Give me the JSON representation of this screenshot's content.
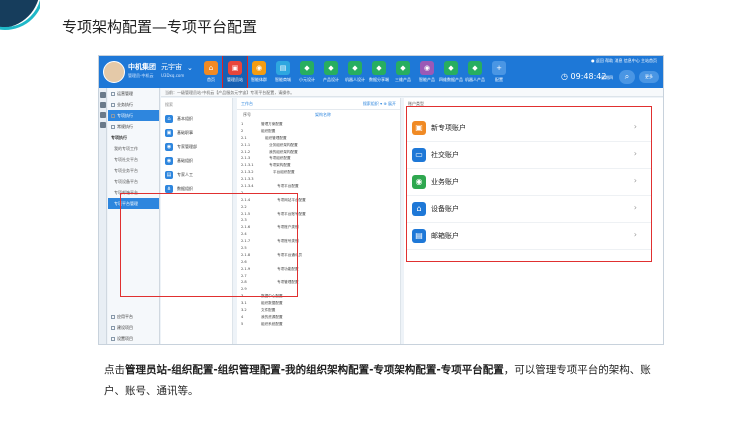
{
  "slide": {
    "title": "专项架构配置—专项平台配置",
    "caption_lead": "点击",
    "caption_path": "管理员站-组织配置-组织管理配置-我的组织架构配置-专项架构配置-专项平台配置",
    "caption_tail": "，可以管理专项平台的架构、账户、账号、通讯等。"
  },
  "app": {
    "company": "中机集团",
    "company_sub": "管理员-中机云",
    "universe": "元宇宙",
    "universe_sub": "U3Dxq.com",
    "nav": [
      {
        "label": "首页",
        "color": "#f08a24",
        "icon": "⌂"
      },
      {
        "label": "管理员站",
        "color": "#e8463c",
        "icon": "▣",
        "active": true
      },
      {
        "label": "智能体群",
        "color": "#f39c12",
        "icon": "◉"
      },
      {
        "label": "智能商城",
        "color": "#2ea7e0",
        "icon": "▤"
      },
      {
        "label": "小元设计",
        "color": "#27ae60",
        "icon": "◆"
      },
      {
        "label": "产品设计",
        "color": "#27ae60",
        "icon": "◆"
      },
      {
        "label": "机器人设计",
        "color": "#27ae60",
        "icon": "◆"
      },
      {
        "label": "数据分享端",
        "color": "#27ae60",
        "icon": "◆"
      },
      {
        "label": "三维产品",
        "color": "#27ae60",
        "icon": "◆"
      },
      {
        "label": "智能产品",
        "color": "#9b59b6",
        "icon": "◉"
      },
      {
        "label": "四维数据产品",
        "color": "#27ae60",
        "icon": "◆"
      },
      {
        "label": "机器人产品",
        "color": "#27ae60",
        "icon": "◆"
      },
      {
        "label": "配置",
        "color": "#4a96e4",
        "icon": "+"
      }
    ],
    "top_links": "● 返回   帮助   消息   信息中心   主站首页",
    "clock": "◷ 09:48:42",
    "clock_sub": "星期四",
    "search_icon": "⌕",
    "more": "更多",
    "crumb": "当前：一级管理员站·中机云【产品服务元宇宙】专项平台配置，请操作。",
    "sidebar": [
      {
        "label": "运营管理",
        "type": "item"
      },
      {
        "label": "业务执行",
        "type": "item"
      },
      {
        "label": "专项执行",
        "type": "active"
      },
      {
        "label": "常规执行",
        "type": "item"
      },
      {
        "label": "专项执行",
        "type": "head"
      },
      {
        "label": "我的专项工作",
        "type": "sub"
      },
      {
        "label": "专项社交平台",
        "type": "sub"
      },
      {
        "label": "专项业务平台",
        "type": "sub"
      },
      {
        "label": "专项设备平台",
        "type": "sub"
      },
      {
        "label": "专项邮箱平台",
        "type": "sub"
      },
      {
        "label": "专项平台管理",
        "type": "subactive"
      }
    ],
    "sidebar_bottom": [
      "应用平台",
      "建设项目",
      "设置项目"
    ],
    "panel_a_head": "搜索",
    "panel_a_items": [
      {
        "label": "基本组织",
        "icon": "⌂"
      },
      {
        "label": "基础职事",
        "icon": "▣"
      },
      {
        "label": "专家管理部",
        "icon": "◉"
      },
      {
        "label": "基础组织",
        "icon": "◉"
      },
      {
        "label": "专家人工",
        "icon": "▤"
      },
      {
        "label": "数据组织",
        "icon": "⋔"
      }
    ],
    "panel_b_head": "工作台",
    "panel_b_search": "搜索组织 ▾  ⊕ 展开",
    "tree_col1": "序号",
    "tree_col2": "架构名称",
    "tree_rows": [
      {
        "num": "1",
        "label": "管理方案配置",
        "indent": 0
      },
      {
        "num": "2",
        "label": "组织配置",
        "indent": 0
      },
      {
        "num": "2.1",
        "label": "组织管理配置",
        "indent": 1
      },
      {
        "num": "2.1.1",
        "label": "业务组织架构配置",
        "indent": 2
      },
      {
        "num": "2.1.2",
        "label": "我的组织架构配置",
        "indent": 2
      },
      {
        "num": "2.1.3",
        "label": "专项组织配置",
        "indent": 2
      },
      {
        "num": "2.1.3.1",
        "label": "专项架构配置",
        "indent": 2
      },
      {
        "num": "2.1.3.2",
        "label": "平台组织配置",
        "indent": 3
      },
      {
        "num": "2.1.3.3",
        "label": "",
        "indent": 3
      },
      {
        "num": "2.1.3.4",
        "label": "专项平台配置",
        "indent": 4
      },
      {
        "num": "2",
        "label": "",
        "indent": 4
      },
      {
        "num": "2.1.4",
        "label": "专项网站平台配置",
        "indent": 4
      },
      {
        "num": "2.2",
        "label": "",
        "indent": 4
      },
      {
        "num": "2.1.5",
        "label": "专项平台账号配置",
        "indent": 4
      },
      {
        "num": "2.3",
        "label": "",
        "indent": 4
      },
      {
        "num": "2.1.6",
        "label": "专项账户类别",
        "indent": 4
      },
      {
        "num": "2.4",
        "label": "",
        "indent": 4
      },
      {
        "num": "2.1.7",
        "label": "专项账号类别",
        "indent": 4
      },
      {
        "num": "2.5",
        "label": "",
        "indent": 4
      },
      {
        "num": "2.1.8",
        "label": "专项平台通讯员",
        "indent": 4
      },
      {
        "num": "2.6",
        "label": "",
        "indent": 4
      },
      {
        "num": "2.1.9",
        "label": "专项功能配置",
        "indent": 4
      },
      {
        "num": "2.7",
        "label": "",
        "indent": 4
      },
      {
        "num": "2.8",
        "label": "专项管理配置",
        "indent": 4
      },
      {
        "num": "2.9",
        "label": "",
        "indent": 4
      },
      {
        "num": "3",
        "label": "数据中心配置",
        "indent": 0
      },
      {
        "num": "3.1",
        "label": "组织数据配置",
        "indent": 0
      },
      {
        "num": "3.2",
        "label": "文件配置",
        "indent": 0
      },
      {
        "num": "4",
        "label": "我的资源配置",
        "indent": 0
      },
      {
        "num": "5",
        "label": "组织系统配置",
        "indent": 0
      }
    ],
    "panel_c_head": "账户类型",
    "accounts": [
      {
        "label": "新专项账户",
        "color": "#f08a24",
        "icon": "▣"
      },
      {
        "label": "社交账户",
        "color": "#1e78d7",
        "icon": "▭"
      },
      {
        "label": "业务账户",
        "color": "#2ea74f",
        "icon": "◉"
      },
      {
        "label": "设备账户",
        "color": "#1e78d7",
        "icon": "⌂"
      },
      {
        "label": "邮箱账户",
        "color": "#1e78d7",
        "icon": "▤"
      }
    ],
    "chevron": "›"
  }
}
